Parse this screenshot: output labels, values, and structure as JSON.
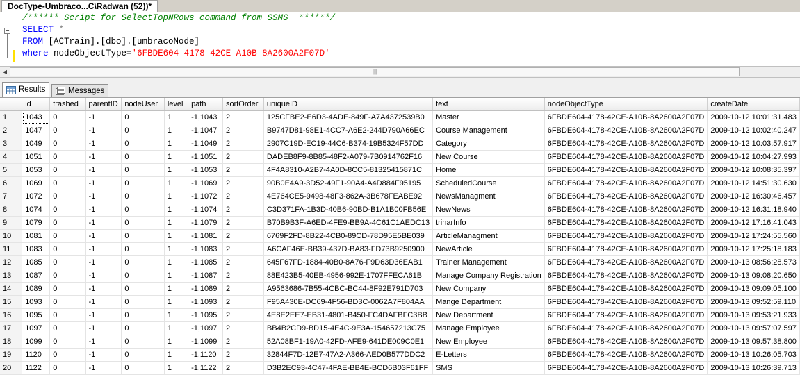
{
  "tab": {
    "title": "DocType-Umbraco...C\\Radwan (52))*"
  },
  "editor": {
    "comment": "/****** Script for SelectTopNRows command from SSMS  ******/",
    "select_kw": "SELECT",
    "select_rest": " *",
    "from_kw": "FROM",
    "from_rest": " [ACTrain].[dbo].[umbracoNode]",
    "where_kw": "where",
    "where_col": " nodeObjectType",
    "where_eq": "=",
    "where_val": "'6FBDE604-4178-42CE-A10B-8A2600A2F07D'"
  },
  "results_tabs": {
    "results": "Results",
    "messages": "Messages"
  },
  "grid": {
    "columns": [
      "id",
      "trashed",
      "parentID",
      "nodeUser",
      "level",
      "path",
      "sortOrder",
      "uniqueID",
      "text",
      "nodeObjectType",
      "createDate"
    ],
    "rows": [
      [
        "1",
        "1043",
        "0",
        "-1",
        "0",
        "1",
        "-1,1043",
        "2",
        "125CFBE2-E6D3-4ADE-849F-A7A4372539B0",
        "Master",
        "6FBDE604-4178-42CE-A10B-8A2600A2F07D",
        "2009-10-12 10:01:31.483"
      ],
      [
        "2",
        "1047",
        "0",
        "-1",
        "0",
        "1",
        "-1,1047",
        "2",
        "B9747D81-98E1-4CC7-A6E2-244D790A66EC",
        "Course Management",
        "6FBDE604-4178-42CE-A10B-8A2600A2F07D",
        "2009-10-12 10:02:40.247"
      ],
      [
        "3",
        "1049",
        "0",
        "-1",
        "0",
        "1",
        "-1,1049",
        "2",
        "2907C19D-EC19-44C6-B374-19B5324F57DD",
        "Category",
        "6FBDE604-4178-42CE-A10B-8A2600A2F07D",
        "2009-10-12 10:03:57.917"
      ],
      [
        "4",
        "1051",
        "0",
        "-1",
        "0",
        "1",
        "-1,1051",
        "2",
        "DADEB8F9-8B85-48F2-A079-7B0914762F16",
        "New Course",
        "6FBDE604-4178-42CE-A10B-8A2600A2F07D",
        "2009-10-12 10:04:27.993"
      ],
      [
        "5",
        "1053",
        "0",
        "-1",
        "0",
        "1",
        "-1,1053",
        "2",
        "4F4A8310-A2B7-4A0D-8CC5-81325415871C",
        "Home",
        "6FBDE604-4178-42CE-A10B-8A2600A2F07D",
        "2009-10-12 10:08:35.397"
      ],
      [
        "6",
        "1069",
        "0",
        "-1",
        "0",
        "1",
        "-1,1069",
        "2",
        "90B0E4A9-3D52-49F1-90A4-A4D884F95195",
        "ScheduledCourse",
        "6FBDE604-4178-42CE-A10B-8A2600A2F07D",
        "2009-10-12 14:51:30.630"
      ],
      [
        "7",
        "1072",
        "0",
        "-1",
        "0",
        "1",
        "-1,1072",
        "2",
        "4E764CE5-9498-48F3-862A-3B678FEABE92",
        "NewsManagment",
        "6FBDE604-4178-42CE-A10B-8A2600A2F07D",
        "2009-10-12 16:30:46.457"
      ],
      [
        "8",
        "1074",
        "0",
        "-1",
        "0",
        "1",
        "-1,1074",
        "2",
        "C3D371FA-1B3D-40B6-90BD-B1A1B00FB56E",
        "NewNews",
        "6FBDE604-4178-42CE-A10B-8A2600A2F07D",
        "2009-10-12 16:31:18.940"
      ],
      [
        "9",
        "1079",
        "0",
        "-1",
        "0",
        "1",
        "-1,1079",
        "2",
        "B70B9B3F-A6ED-4FE9-BB9A-4C61C1AEDC13",
        "trinarInfo",
        "6FBDE604-4178-42CE-A10B-8A2600A2F07D",
        "2009-10-12 17:16:41.043"
      ],
      [
        "10",
        "1081",
        "0",
        "-1",
        "0",
        "1",
        "-1,1081",
        "2",
        "6769F2FD-8B22-4CB0-89CD-78D95E5BE039",
        "ArticleManagment",
        "6FBDE604-4178-42CE-A10B-8A2600A2F07D",
        "2009-10-12 17:24:55.560"
      ],
      [
        "11",
        "1083",
        "0",
        "-1",
        "0",
        "1",
        "-1,1083",
        "2",
        "A6CAF46E-BB39-437D-BA83-FD73B9250900",
        "NewArticle",
        "6FBDE604-4178-42CE-A10B-8A2600A2F07D",
        "2009-10-12 17:25:18.183"
      ],
      [
        "12",
        "1085",
        "0",
        "-1",
        "0",
        "1",
        "-1,1085",
        "2",
        "645F67FD-1884-40B0-8A76-F9D63D36EAB1",
        "Trainer Management",
        "6FBDE604-4178-42CE-A10B-8A2600A2F07D",
        "2009-10-13 08:56:28.573"
      ],
      [
        "13",
        "1087",
        "0",
        "-1",
        "0",
        "1",
        "-1,1087",
        "2",
        "88E423B5-40EB-4956-992E-1707FFECA61B",
        "Manage Company Registration",
        "6FBDE604-4178-42CE-A10B-8A2600A2F07D",
        "2009-10-13 09:08:20.650"
      ],
      [
        "14",
        "1089",
        "0",
        "-1",
        "0",
        "1",
        "-1,1089",
        "2",
        "A9563686-7B55-4CBC-BC44-8F92E791D703",
        "New Company",
        "6FBDE604-4178-42CE-A10B-8A2600A2F07D",
        "2009-10-13 09:09:05.100"
      ],
      [
        "15",
        "1093",
        "0",
        "-1",
        "0",
        "1",
        "-1,1093",
        "2",
        "F95A430E-DC69-4F56-BD3C-0062A7F804AA",
        "Mange Department",
        "6FBDE604-4178-42CE-A10B-8A2600A2F07D",
        "2009-10-13 09:52:59.110"
      ],
      [
        "16",
        "1095",
        "0",
        "-1",
        "0",
        "1",
        "-1,1095",
        "2",
        "4E8E2EE7-EB31-4801-B450-FC4DAFBFC3BB",
        "New Department",
        "6FBDE604-4178-42CE-A10B-8A2600A2F07D",
        "2009-10-13 09:53:21.933"
      ],
      [
        "17",
        "1097",
        "0",
        "-1",
        "0",
        "1",
        "-1,1097",
        "2",
        "BB4B2CD9-BD15-4E4C-9E3A-154657213C75",
        "Manage Employee",
        "6FBDE604-4178-42CE-A10B-8A2600A2F07D",
        "2009-10-13 09:57:07.597"
      ],
      [
        "18",
        "1099",
        "0",
        "-1",
        "0",
        "1",
        "-1,1099",
        "2",
        "52A08BF1-19A0-42FD-AFE9-641DE009C0E1",
        "New Employee",
        "6FBDE604-4178-42CE-A10B-8A2600A2F07D",
        "2009-10-13 09:57:38.800"
      ],
      [
        "19",
        "1120",
        "0",
        "-1",
        "0",
        "1",
        "-1,1120",
        "2",
        "32844F7D-12E7-47A2-A366-AED0B577DDC2",
        "E-Letters",
        "6FBDE604-4178-42CE-A10B-8A2600A2F07D",
        "2009-10-13 10:26:05.703"
      ],
      [
        "20",
        "1122",
        "0",
        "-1",
        "0",
        "1",
        "-1,1122",
        "2",
        "D3B2EC93-4C47-4FAE-BB4E-BCD6B03F61FF",
        "SMS",
        "6FBDE604-4178-42CE-A10B-8A2600A2F07D",
        "2009-10-13 10:26:39.713"
      ]
    ]
  },
  "colors": {
    "keyword": "#0000ff",
    "comment": "#008000",
    "string": "#ff0000",
    "change_bar": "#ffe000"
  }
}
